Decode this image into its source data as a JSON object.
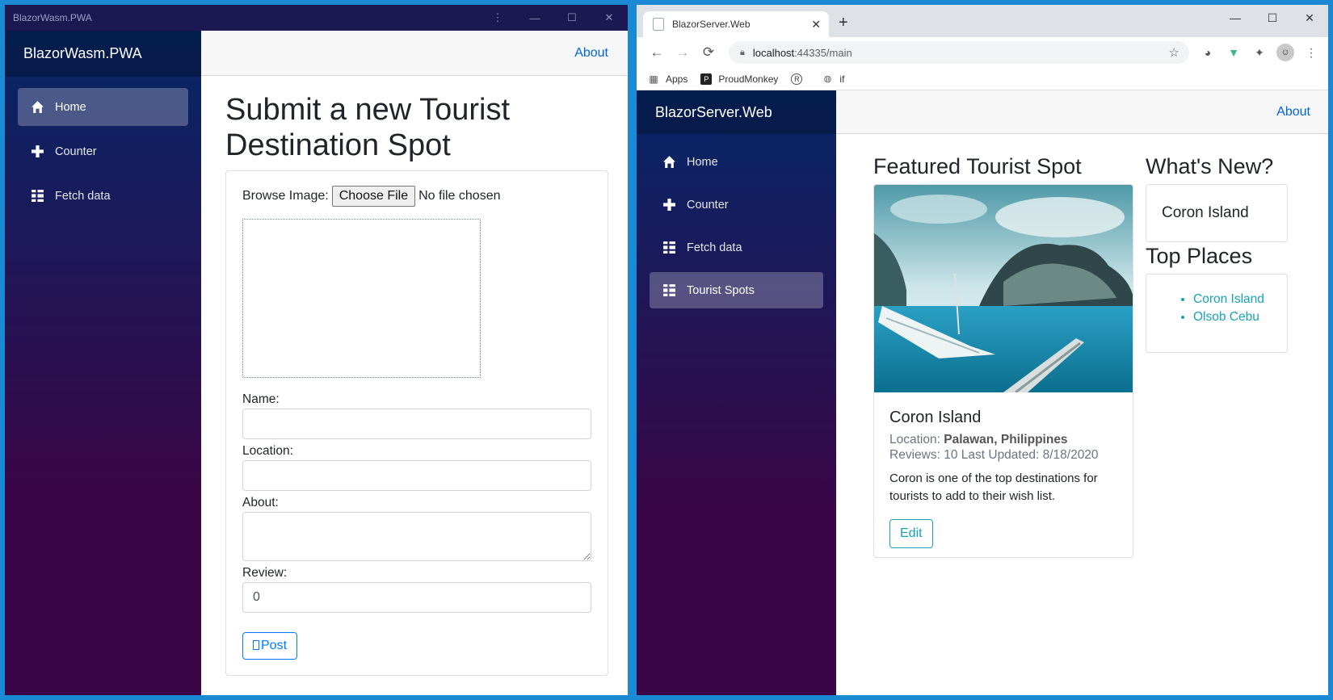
{
  "left_window": {
    "title": "BlazorWasm.PWA",
    "controls": [
      "⋮",
      "—",
      "☐",
      "✕"
    ],
    "brand": "BlazorWasm.PWA",
    "nav": [
      {
        "label": "Home",
        "icon": "home-icon",
        "active": true
      },
      {
        "label": "Counter",
        "icon": "plus-icon",
        "active": false
      },
      {
        "label": "Fetch data",
        "icon": "list-icon",
        "active": false
      }
    ],
    "about_link": "About",
    "heading": "Submit a new Tourist Destination Spot",
    "form": {
      "browse_label": "Browse Image:",
      "choose_file_button": "Choose File",
      "no_file_text": "No file chosen",
      "name_label": "Name:",
      "name_value": "",
      "location_label": "Location:",
      "location_value": "",
      "about_label": "About:",
      "about_value": "",
      "review_label": "Review:",
      "review_value": "0",
      "post_button": "Post"
    }
  },
  "right_window": {
    "tab_title": "BlazorServer.Web",
    "url_host": "localhost",
    "url_rest": ":44335/main",
    "bookmarks": [
      {
        "label": "Apps",
        "icon": "apps-grid-icon"
      },
      {
        "label": "ProudMonkey",
        "icon": "proudmonkey-icon"
      },
      {
        "label": "",
        "icon": "r-icon"
      },
      {
        "label": "if",
        "icon": "globe-icon"
      }
    ],
    "brand": "BlazorServer.Web",
    "nav": [
      {
        "label": "Home",
        "icon": "home-icon",
        "active": false
      },
      {
        "label": "Counter",
        "icon": "plus-icon",
        "active": false
      },
      {
        "label": "Fetch data",
        "icon": "list-icon",
        "active": false
      },
      {
        "label": "Tourist Spots",
        "icon": "list-icon",
        "active": true
      }
    ],
    "about_link": "About",
    "featured": {
      "heading": "Featured Tourist Spot",
      "title": "Coron Island",
      "location_label": "Location:",
      "location_value": "Palawan, Philippines",
      "reviews_label": "Reviews:",
      "reviews_value": "10",
      "updated_label": "Last Updated:",
      "updated_value": "8/18/2020",
      "description": "Coron is one of the top destinations for tourists to add to their wish list.",
      "edit_button": "Edit"
    },
    "whats_new": {
      "heading": "What's New?",
      "item": "Coron Island"
    },
    "top_places": {
      "heading": "Top Places",
      "items": [
        "Coron Island",
        "Olsob Cebu"
      ]
    }
  }
}
